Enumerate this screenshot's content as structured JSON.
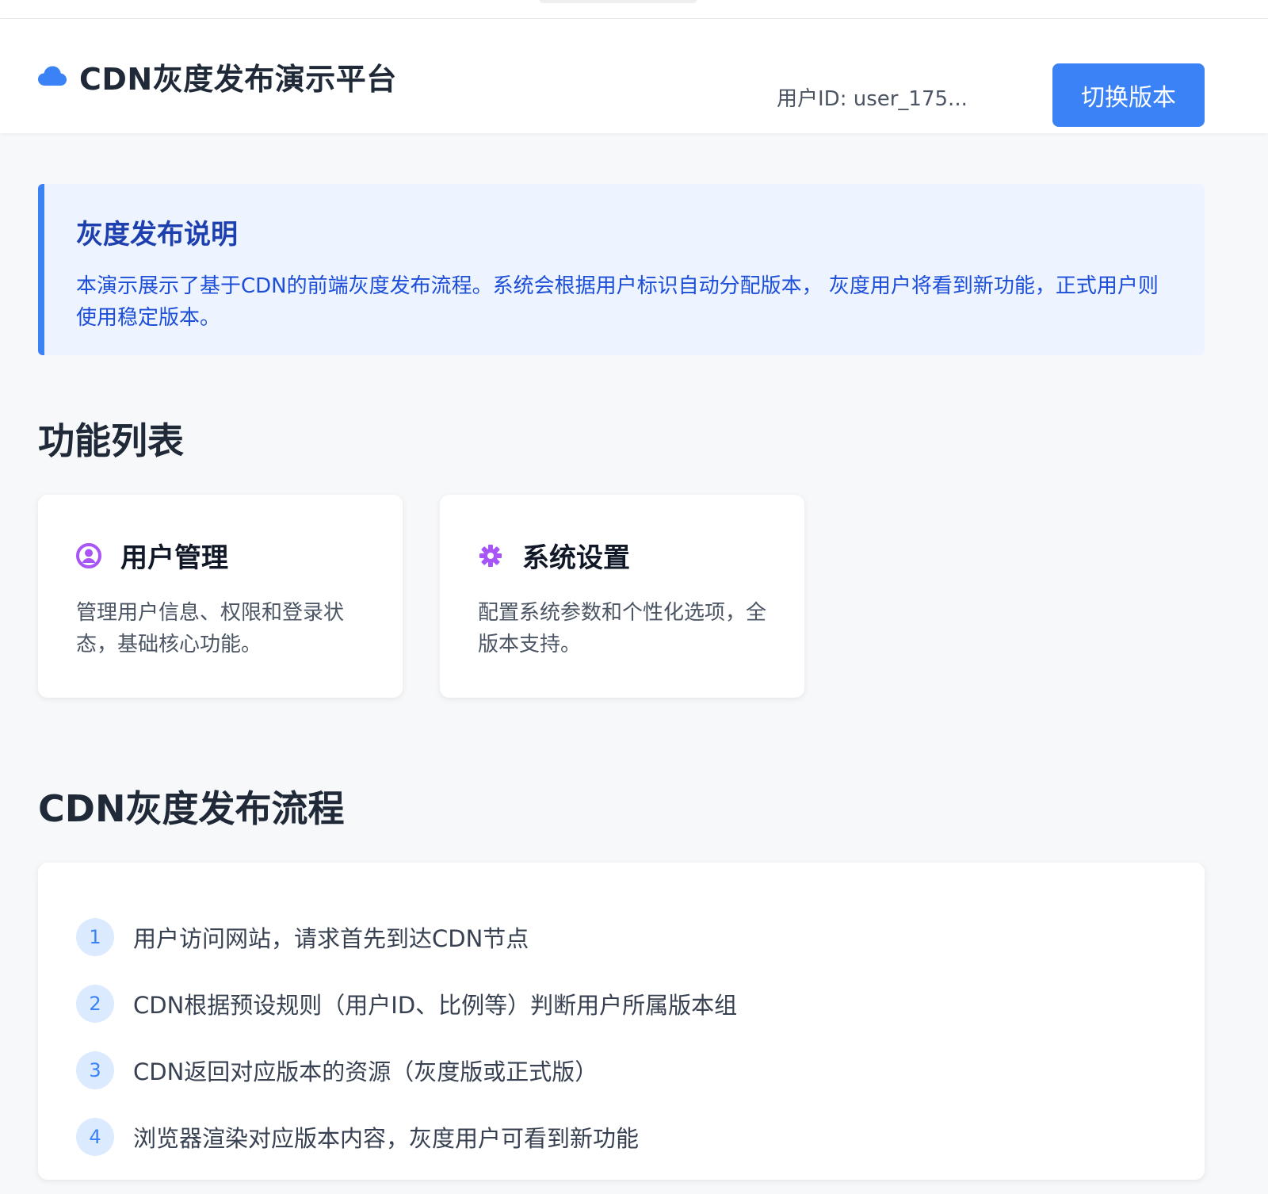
{
  "header": {
    "title": "CDN灰度发布演示平台",
    "user_id": "用户ID: user_175...",
    "switch_label": "切换版本",
    "brand_icon": "cloud-icon",
    "accent_color": "#3b82f6"
  },
  "notice": {
    "title": "灰度发布说明",
    "text": "本演示展示了基于CDN的前端灰度发布流程。系统会根据用户标识自动分配版本， 灰度用户将看到新功能，正式用户则使用稳定版本。"
  },
  "features": {
    "title": "功能列表",
    "items": [
      {
        "icon": "user-circle-icon",
        "title": "用户管理",
        "desc": "管理用户信息、权限和登录状态，基础核心功能。"
      },
      {
        "icon": "gear-icon",
        "title": "系统设置",
        "desc": "配置系统参数和个性化选项，全版本支持。"
      }
    ]
  },
  "flow": {
    "title": "CDN灰度发布流程",
    "steps": [
      {
        "num": "1",
        "text": "用户访问网站，请求首先到达CDN节点"
      },
      {
        "num": "2",
        "text": "CDN根据预设规则（用户ID、比例等）判断用户所属版本组"
      },
      {
        "num": "3",
        "text": "CDN返回对应版本的资源（灰度版或正式版）"
      },
      {
        "num": "4",
        "text": "浏览器渲染对应版本内容，灰度用户可看到新功能"
      }
    ]
  }
}
